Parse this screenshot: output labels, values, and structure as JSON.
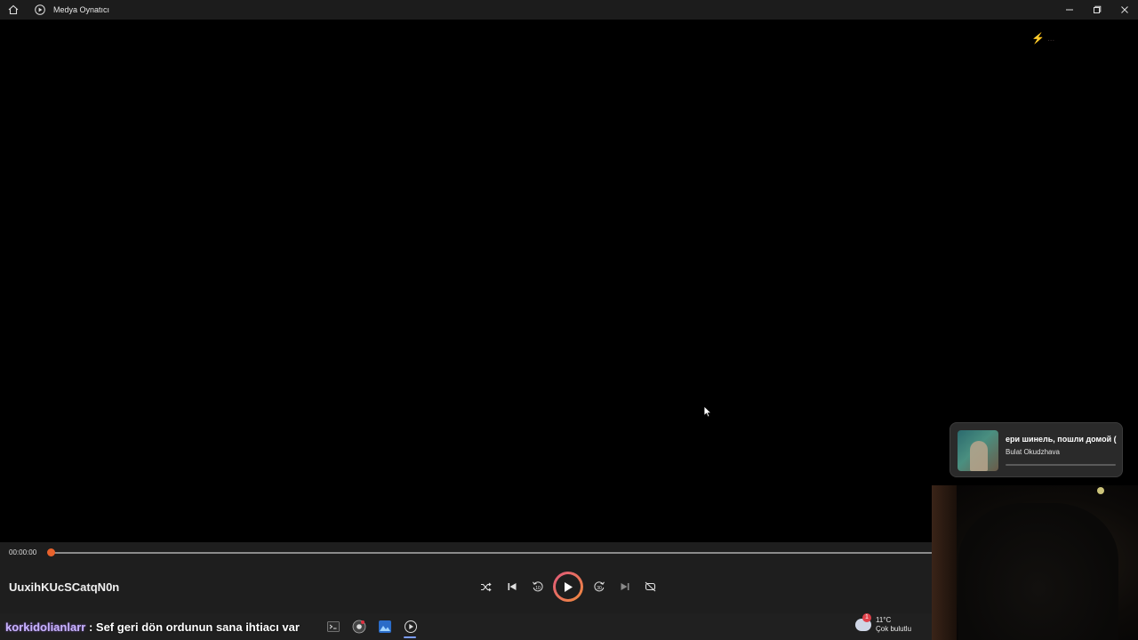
{
  "titlebar": {
    "app_title": "Medya Oynatıcı",
    "icons": [
      "home-icon",
      "media-player-icon"
    ],
    "window_controls": [
      "minimize-icon",
      "restore-icon",
      "close-icon"
    ]
  },
  "video": {
    "watermark": "..."
  },
  "player": {
    "current_time": "00:00:00",
    "progress": 0,
    "media_title": "UuxihKUcSCatqN0n",
    "controls": [
      "shuffle-icon",
      "previous-icon",
      "rewind-10-icon",
      "play-icon",
      "forward-30-icon",
      "next-icon",
      "repeat-off-icon"
    ],
    "rewind_label": "10",
    "forward_label": "30",
    "accent_color": "#e8622c"
  },
  "now_playing": {
    "title": "ери шинель, пошли домой (",
    "artist": "Bulat Okudzhava",
    "progress": 0
  },
  "taskbar": {
    "chat_user": "korkidolianlarr",
    "chat_separator": ":",
    "chat_message": "Sef geri dön ordunun sana ihtiacı var",
    "weather_temp": "11°C",
    "weather_desc": "Çok bulutlu",
    "weather_badge": "1"
  }
}
